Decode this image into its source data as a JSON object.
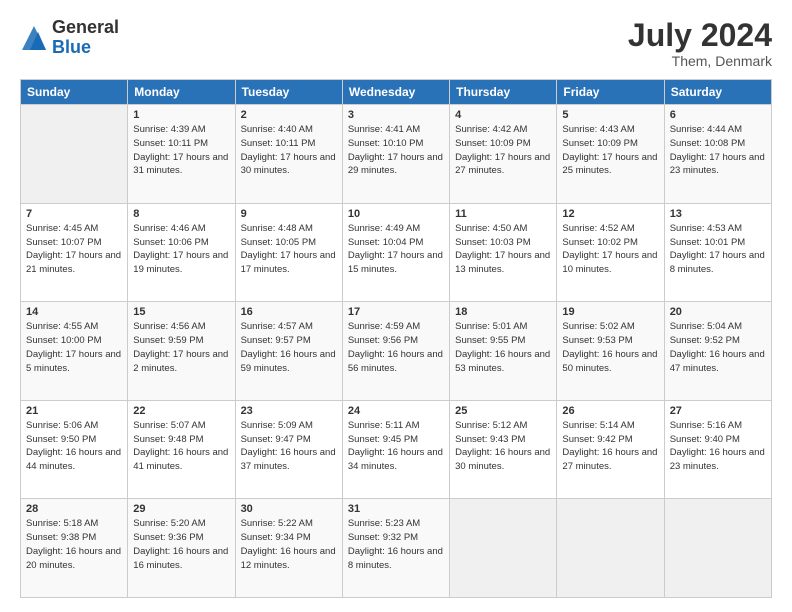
{
  "header": {
    "logo_line1": "General",
    "logo_line2": "Blue",
    "title": "July 2024",
    "subtitle": "Them, Denmark"
  },
  "columns": [
    "Sunday",
    "Monday",
    "Tuesday",
    "Wednesday",
    "Thursday",
    "Friday",
    "Saturday"
  ],
  "weeks": [
    [
      {
        "day": "",
        "sunrise": "",
        "sunset": "",
        "daylight": ""
      },
      {
        "day": "1",
        "sunrise": "Sunrise: 4:39 AM",
        "sunset": "Sunset: 10:11 PM",
        "daylight": "Daylight: 17 hours and 31 minutes."
      },
      {
        "day": "2",
        "sunrise": "Sunrise: 4:40 AM",
        "sunset": "Sunset: 10:11 PM",
        "daylight": "Daylight: 17 hours and 30 minutes."
      },
      {
        "day": "3",
        "sunrise": "Sunrise: 4:41 AM",
        "sunset": "Sunset: 10:10 PM",
        "daylight": "Daylight: 17 hours and 29 minutes."
      },
      {
        "day": "4",
        "sunrise": "Sunrise: 4:42 AM",
        "sunset": "Sunset: 10:09 PM",
        "daylight": "Daylight: 17 hours and 27 minutes."
      },
      {
        "day": "5",
        "sunrise": "Sunrise: 4:43 AM",
        "sunset": "Sunset: 10:09 PM",
        "daylight": "Daylight: 17 hours and 25 minutes."
      },
      {
        "day": "6",
        "sunrise": "Sunrise: 4:44 AM",
        "sunset": "Sunset: 10:08 PM",
        "daylight": "Daylight: 17 hours and 23 minutes."
      }
    ],
    [
      {
        "day": "7",
        "sunrise": "Sunrise: 4:45 AM",
        "sunset": "Sunset: 10:07 PM",
        "daylight": "Daylight: 17 hours and 21 minutes."
      },
      {
        "day": "8",
        "sunrise": "Sunrise: 4:46 AM",
        "sunset": "Sunset: 10:06 PM",
        "daylight": "Daylight: 17 hours and 19 minutes."
      },
      {
        "day": "9",
        "sunrise": "Sunrise: 4:48 AM",
        "sunset": "Sunset: 10:05 PM",
        "daylight": "Daylight: 17 hours and 17 minutes."
      },
      {
        "day": "10",
        "sunrise": "Sunrise: 4:49 AM",
        "sunset": "Sunset: 10:04 PM",
        "daylight": "Daylight: 17 hours and 15 minutes."
      },
      {
        "day": "11",
        "sunrise": "Sunrise: 4:50 AM",
        "sunset": "Sunset: 10:03 PM",
        "daylight": "Daylight: 17 hours and 13 minutes."
      },
      {
        "day": "12",
        "sunrise": "Sunrise: 4:52 AM",
        "sunset": "Sunset: 10:02 PM",
        "daylight": "Daylight: 17 hours and 10 minutes."
      },
      {
        "day": "13",
        "sunrise": "Sunrise: 4:53 AM",
        "sunset": "Sunset: 10:01 PM",
        "daylight": "Daylight: 17 hours and 8 minutes."
      }
    ],
    [
      {
        "day": "14",
        "sunrise": "Sunrise: 4:55 AM",
        "sunset": "Sunset: 10:00 PM",
        "daylight": "Daylight: 17 hours and 5 minutes."
      },
      {
        "day": "15",
        "sunrise": "Sunrise: 4:56 AM",
        "sunset": "Sunset: 9:59 PM",
        "daylight": "Daylight: 17 hours and 2 minutes."
      },
      {
        "day": "16",
        "sunrise": "Sunrise: 4:57 AM",
        "sunset": "Sunset: 9:57 PM",
        "daylight": "Daylight: 16 hours and 59 minutes."
      },
      {
        "day": "17",
        "sunrise": "Sunrise: 4:59 AM",
        "sunset": "Sunset: 9:56 PM",
        "daylight": "Daylight: 16 hours and 56 minutes."
      },
      {
        "day": "18",
        "sunrise": "Sunrise: 5:01 AM",
        "sunset": "Sunset: 9:55 PM",
        "daylight": "Daylight: 16 hours and 53 minutes."
      },
      {
        "day": "19",
        "sunrise": "Sunrise: 5:02 AM",
        "sunset": "Sunset: 9:53 PM",
        "daylight": "Daylight: 16 hours and 50 minutes."
      },
      {
        "day": "20",
        "sunrise": "Sunrise: 5:04 AM",
        "sunset": "Sunset: 9:52 PM",
        "daylight": "Daylight: 16 hours and 47 minutes."
      }
    ],
    [
      {
        "day": "21",
        "sunrise": "Sunrise: 5:06 AM",
        "sunset": "Sunset: 9:50 PM",
        "daylight": "Daylight: 16 hours and 44 minutes."
      },
      {
        "day": "22",
        "sunrise": "Sunrise: 5:07 AM",
        "sunset": "Sunset: 9:48 PM",
        "daylight": "Daylight: 16 hours and 41 minutes."
      },
      {
        "day": "23",
        "sunrise": "Sunrise: 5:09 AM",
        "sunset": "Sunset: 9:47 PM",
        "daylight": "Daylight: 16 hours and 37 minutes."
      },
      {
        "day": "24",
        "sunrise": "Sunrise: 5:11 AM",
        "sunset": "Sunset: 9:45 PM",
        "daylight": "Daylight: 16 hours and 34 minutes."
      },
      {
        "day": "25",
        "sunrise": "Sunrise: 5:12 AM",
        "sunset": "Sunset: 9:43 PM",
        "daylight": "Daylight: 16 hours and 30 minutes."
      },
      {
        "day": "26",
        "sunrise": "Sunrise: 5:14 AM",
        "sunset": "Sunset: 9:42 PM",
        "daylight": "Daylight: 16 hours and 27 minutes."
      },
      {
        "day": "27",
        "sunrise": "Sunrise: 5:16 AM",
        "sunset": "Sunset: 9:40 PM",
        "daylight": "Daylight: 16 hours and 23 minutes."
      }
    ],
    [
      {
        "day": "28",
        "sunrise": "Sunrise: 5:18 AM",
        "sunset": "Sunset: 9:38 PM",
        "daylight": "Daylight: 16 hours and 20 minutes."
      },
      {
        "day": "29",
        "sunrise": "Sunrise: 5:20 AM",
        "sunset": "Sunset: 9:36 PM",
        "daylight": "Daylight: 16 hours and 16 minutes."
      },
      {
        "day": "30",
        "sunrise": "Sunrise: 5:22 AM",
        "sunset": "Sunset: 9:34 PM",
        "daylight": "Daylight: 16 hours and 12 minutes."
      },
      {
        "day": "31",
        "sunrise": "Sunrise: 5:23 AM",
        "sunset": "Sunset: 9:32 PM",
        "daylight": "Daylight: 16 hours and 8 minutes."
      },
      {
        "day": "",
        "sunrise": "",
        "sunset": "",
        "daylight": ""
      },
      {
        "day": "",
        "sunrise": "",
        "sunset": "",
        "daylight": ""
      },
      {
        "day": "",
        "sunrise": "",
        "sunset": "",
        "daylight": ""
      }
    ]
  ]
}
